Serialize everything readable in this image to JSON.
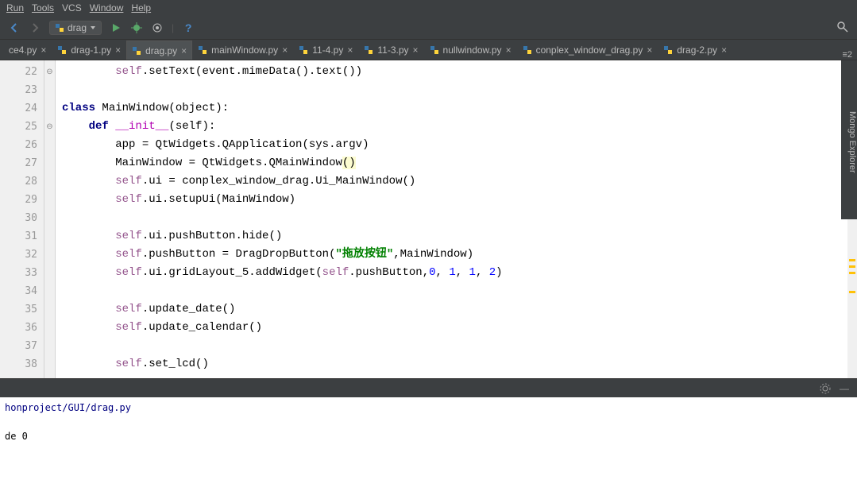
{
  "menu": [
    "Run",
    "Tools",
    "VCS",
    "Window",
    "Help"
  ],
  "runConfig": {
    "icon": "python-icon",
    "label": "drag"
  },
  "tabs": [
    {
      "name": "ce4.py",
      "active": false
    },
    {
      "name": "drag-1.py",
      "active": false
    },
    {
      "name": "drag.py",
      "active": true
    },
    {
      "name": "mainWindow.py",
      "active": false
    },
    {
      "name": "11-4.py",
      "active": false
    },
    {
      "name": "11-3.py",
      "active": false
    },
    {
      "name": "nullwindow.py",
      "active": false
    },
    {
      "name": "conplex_window_drag.py",
      "active": false
    },
    {
      "name": "drag-2.py",
      "active": false
    }
  ],
  "tabSplitBadge": "≡2",
  "gutterStart": 22,
  "gutterEnd": 38,
  "code": {
    "l22": {
      "prefix": "        ",
      "self": "self",
      "rest1": ".setText(event.mimeData().text())"
    },
    "l24": {
      "kw": "class",
      "name": " MainWindow(",
      "obj": "object",
      "tail": "):"
    },
    "l25": {
      "indent": "    ",
      "kw": "def ",
      "magic": "__init__",
      "params": "(self):"
    },
    "l26": {
      "indent": "        ",
      "text": "app = QtWidgets.QApplication(sys.argv)"
    },
    "l27": {
      "indent": "        ",
      "text": "MainWindow = QtWidgets.QMainWindow",
      "paren": "()"
    },
    "l28": {
      "indent": "        ",
      "self": "self",
      "text": ".ui = conplex_window_drag.Ui_MainWindow()"
    },
    "l29": {
      "indent": "        ",
      "self": "self",
      "text": ".ui.setupUi(MainWindow)"
    },
    "l31": {
      "indent": "        ",
      "self": "self",
      "text": ".ui.pushButton.hide()"
    },
    "l32": {
      "indent": "        ",
      "self": "self",
      "text1": ".pushButton = DragDropButton(",
      "str": "\"拖放按钮\"",
      "text2": ",MainWindow)"
    },
    "l33": {
      "indent": "        ",
      "self": "self",
      "text1": ".ui.gridLayout_5.addWidget(",
      "self2": "self",
      "text2": ".pushButton,",
      "n0": "0",
      "c1": ", ",
      "n1": "1",
      "c2": ", ",
      "n2": "1",
      "c3": ", ",
      "n3": "2",
      "tail": ")"
    },
    "l35": {
      "indent": "        ",
      "self": "self",
      "text": ".update_date()"
    },
    "l36": {
      "indent": "        ",
      "self": "self",
      "text": ".update_calendar()"
    },
    "l38": {
      "indent": "        ",
      "self": "self",
      "text": ".set_lcd()"
    }
  },
  "console": {
    "path": "honproject/GUI/drag.py",
    "exit": "de 0"
  },
  "sidePanel": "Mongo Explorer"
}
